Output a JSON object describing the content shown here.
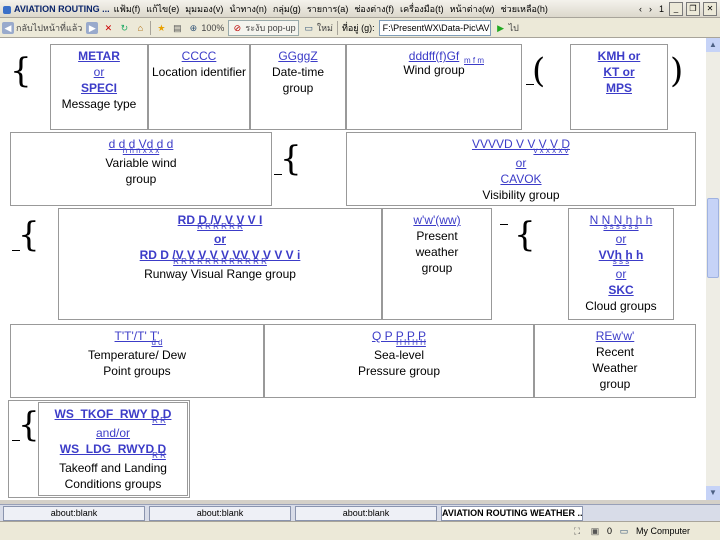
{
  "titlebar": {
    "app_title": "AVIATION ROUTING ...",
    "menu": [
      "แฟ้ม(f)",
      "แก้ไข(e)",
      "มุมมอง(v)",
      "นำทาง(n)",
      "กลุ่ม(g)",
      "รายการ(a)",
      "ช่องต่าง(f)",
      "เครื่องมือ(t)",
      "หน้าต่าง(w)",
      "ช่วยเหลือ(h)"
    ],
    "page_num": "1"
  },
  "toolbar": {
    "back_label": "กลับไปหน้าที่แล้ว",
    "zoom": "100%",
    "popup_label": "ระงับ pop-up",
    "new_label": "ใหม่",
    "address_label": "ที่อยู่ (g):",
    "address_value": "F:\\PresentWX\\Data-Pic\\AVIATION RO",
    "go_label": "ไป"
  },
  "table": {
    "r1": {
      "metar": "METAR",
      "or1": "or",
      "speci": "SPECI",
      "msg_type": "Message type",
      "cccc": "CCCC",
      "loc_id": "Location identifier",
      "gggz": "GGggZ",
      "datetime": "Date-time group",
      "wind_code": "dddff(f)Gf",
      "wind_sub": "m f m",
      "wind_group": "Wind group",
      "kmh": "KMH or",
      "kt": "KT or",
      "mps": "MPS"
    },
    "r2": {
      "var_code": "d d d Vd d d",
      "var_sub": "n n n x x x",
      "var_wind": "Variable wind group",
      "vis_code": "VVVVD V V V V D",
      "vis_sub": "v x x x x v",
      "or": "or",
      "cavok": "CAVOK",
      "vis_group": "Visibility group"
    },
    "r3": {
      "rvr1_code": "RD D /V V V V I",
      "rvr1_sub": "R R R R R R",
      "or": "or",
      "rvr2_code": "RD D /V V V V V VV V V V V i",
      "rvr2_sub": "R R R R R R R R R R R R",
      "rvr_group": "Runway Visual Range group",
      "ww_code": "w'w'(ww)",
      "ww_group": "Present weather group",
      "cloud1_code": "N N N h h h",
      "cloud1_sub": "s s s s s s",
      "or1": "or",
      "vv_code": "VVh h h",
      "vv_sub": "s s s",
      "or2": "or",
      "skc": "SKC",
      "cloud_group": "Cloud groups"
    },
    "r4": {
      "temp_code": "T'T'/T' T'",
      "temp_sub": "d d",
      "temp_group": "Temperature/ Dew Point groups",
      "q_code": "Q P P P P",
      "q_sub": "H H H H",
      "q_group": "Sea-level Pressure group",
      "re_code": "REw'w'",
      "re_group": "Recent Weather group"
    },
    "r5": {
      "tk_code": "WS_TKOF_RWY D D",
      "tk_sub": "R R",
      "andor": "and/or",
      "ld_code": "WS_LDG_RWYD D",
      "ld_sub": "R R",
      "tk_group": "Takeoff and Landing Conditions groups"
    },
    "brace_open": "{",
    "brace_close": "}",
    "paren_open": "(",
    "paren_close": ")"
  },
  "taskbar": {
    "tasks": [
      "about:blank",
      "about:blank",
      "about:blank",
      "AVIATION ROUTING WEATHER ..."
    ]
  },
  "statusbar": {
    "count": "0",
    "zone": "My Computer"
  }
}
